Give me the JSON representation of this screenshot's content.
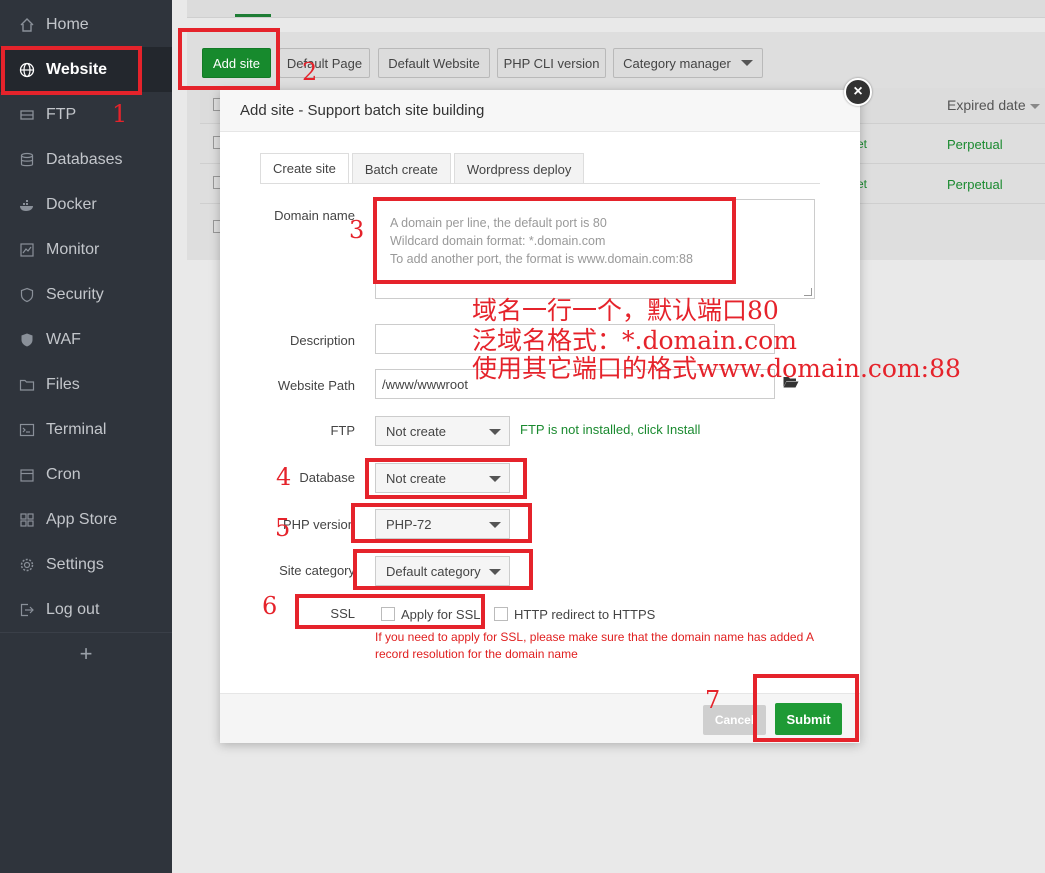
{
  "sidebar": {
    "items": [
      {
        "label": "Home",
        "icon": "home-icon"
      },
      {
        "label": "Website",
        "icon": "globe-icon",
        "active": true
      },
      {
        "label": "FTP",
        "icon": "ftp-icon"
      },
      {
        "label": "Databases",
        "icon": "database-icon"
      },
      {
        "label": "Docker",
        "icon": "docker-icon"
      },
      {
        "label": "Monitor",
        "icon": "monitor-icon"
      },
      {
        "label": "Security",
        "icon": "shield-icon"
      },
      {
        "label": "WAF",
        "icon": "waf-shield-icon"
      },
      {
        "label": "Files",
        "icon": "folder-icon"
      },
      {
        "label": "Terminal",
        "icon": "terminal-icon"
      },
      {
        "label": "Cron",
        "icon": "calendar-icon"
      },
      {
        "label": "App Store",
        "icon": "grid-icon"
      },
      {
        "label": "Settings",
        "icon": "gear-icon"
      },
      {
        "label": "Log out",
        "icon": "logout-icon"
      }
    ],
    "add_label": "+"
  },
  "toolbar": {
    "add_site": "Add site",
    "default_page": "Default Page",
    "default_website": "Default Website",
    "php_cli": "PHP CLI version",
    "category_manager": "Category manager"
  },
  "table": {
    "expired_header": "Expired date",
    "rows": [
      {
        "expired": "Perpetual",
        "partial": "et"
      },
      {
        "expired": "Perpetual",
        "partial": "et"
      }
    ]
  },
  "modal": {
    "title": "Add site - Support batch site building",
    "close": "×",
    "tabs": [
      "Create site",
      "Batch create",
      "Wordpress deploy"
    ],
    "domain_label": "Domain name",
    "domain_placeholder_lines": [
      "A domain per line, the default port is 80",
      "Wildcard domain format: *.domain.com",
      "To add another port, the format is www.domain.com:88"
    ],
    "description_label": "Description",
    "description_value": "",
    "path_label": "Website Path",
    "path_value": "/www/wwwroot",
    "ftp_label": "FTP",
    "ftp_value": "Not create",
    "ftp_hint": "FTP is not installed, click Install",
    "database_label": "Database",
    "database_value": "Not create",
    "php_label": "PHP version",
    "php_value": "PHP-72",
    "category_label": "Site category",
    "category_value": "Default category",
    "ssl_label": "SSL",
    "ssl_apply": "Apply for SSL",
    "ssl_redirect": "HTTP redirect to HTTPS",
    "ssl_note": "If you need to apply for SSL, please make sure that the domain name has added A record resolution for the domain name",
    "cancel": "Cancel",
    "submit": "Submit"
  },
  "annotations": {
    "numbers": [
      "1",
      "2",
      "3",
      "4",
      "5",
      "6",
      "7"
    ],
    "chinese_lines": [
      "域名一行一个，默认端口80",
      "泛域名格式：*.domain.com",
      "使用其它端口的格式www.domain.com:88"
    ],
    "color": "#e5232b"
  }
}
